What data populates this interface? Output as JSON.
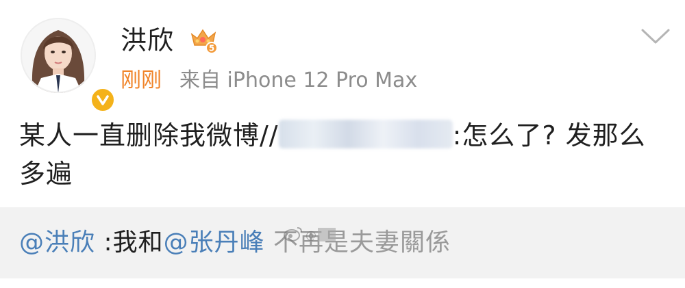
{
  "post": {
    "author_name": "洪欣",
    "time": "刚刚",
    "source": "来自 iPhone 12 Pro Max",
    "content_prefix": "某人一直删除我微博//",
    "content_suffix": ":怎么了? 发那么多遍",
    "vip_level": "5"
  },
  "repost": {
    "mention_author": "@洪欣",
    "colon_text": " :我和",
    "mention_partner": "@张丹峰",
    "rest_text": " 不再是夫妻關係"
  },
  "icons": {
    "verified": "verified-badge-icon",
    "vip": "crown-icon",
    "expand": "chevron-down-icon",
    "watermark": "weibo-watermark-icon"
  },
  "colors": {
    "time": "#f08328",
    "mention": "#4a7fb8",
    "verified": "#f4b21a",
    "repost_bg": "#f2f2f2"
  }
}
